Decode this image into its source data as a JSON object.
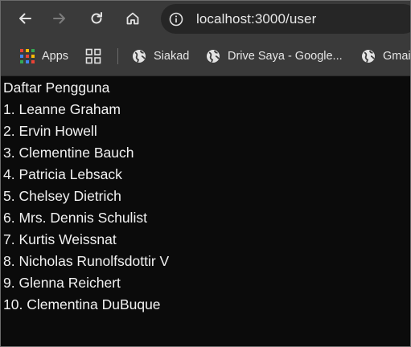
{
  "browser": {
    "url": "localhost:3000/user",
    "icons": {
      "back": "arrow-left-icon",
      "forward": "arrow-right-icon",
      "reload": "reload-icon",
      "home": "home-icon",
      "site_info": "info-icon"
    }
  },
  "bookmarks": {
    "apps_label": "Apps",
    "siakad_label": "Siakad",
    "drive_label": "Drive Saya - Google...",
    "gmail_label": "Gmai"
  },
  "page": {
    "title": "Daftar Pengguna",
    "users": [
      "1. Leanne Graham",
      "2. Ervin Howell",
      "3. Clementine Bauch",
      "4. Patricia Lebsack",
      "5. Chelsey Dietrich",
      "6. Mrs. Dennis Schulist",
      "7. Kurtis Weissnat",
      "8. Nicholas Runolfsdottir V",
      "9. Glenna Reichert",
      "10. Clementina DuBuque"
    ]
  },
  "colors": {
    "toolbar": "#3a3a3a",
    "omnibox": "#262626",
    "page_background": "#0b0b0b",
    "text": "#f2f2f2"
  }
}
